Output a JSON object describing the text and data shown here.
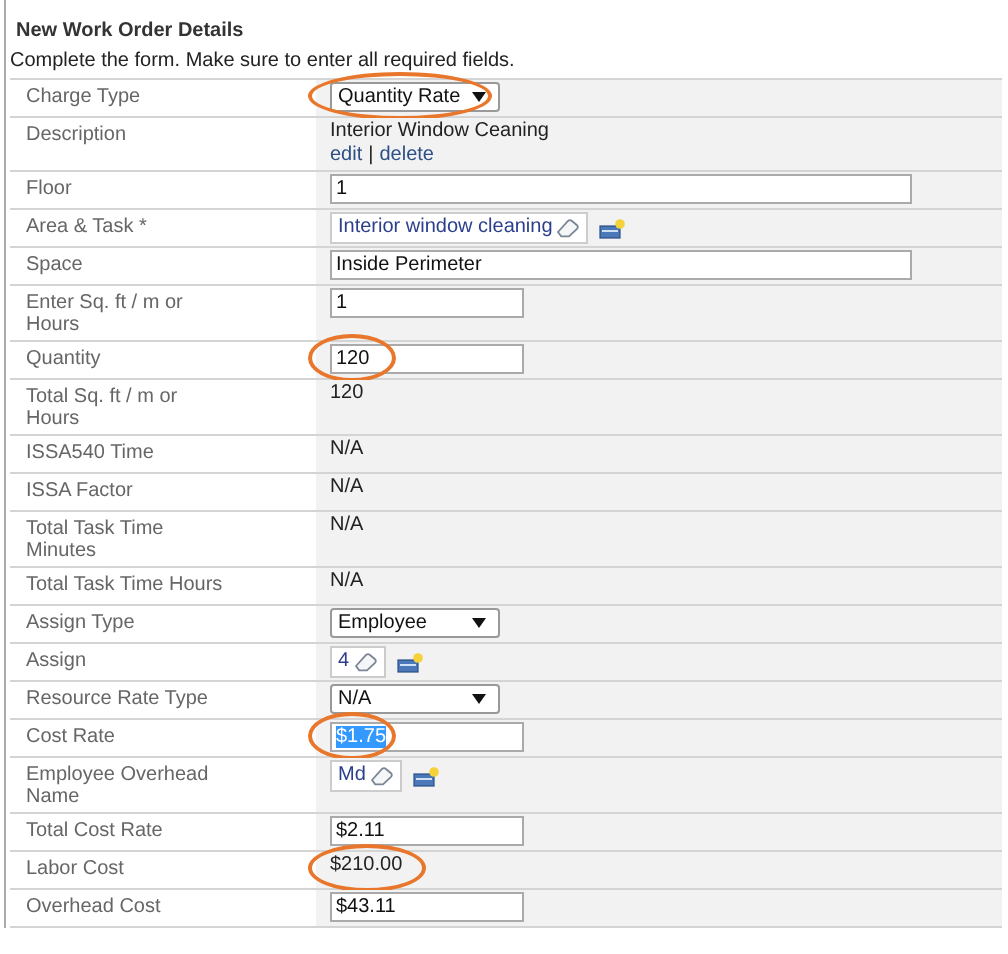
{
  "title": "New Work Order Details",
  "instructions": "Complete the form. Make sure to enter all required fields.",
  "rows": [
    {
      "label": "Charge Type",
      "kind": "select_compact",
      "value": "Quantity Rate",
      "circled": true
    },
    {
      "label": "Description",
      "kind": "links",
      "value": "Interior Window Ceaning",
      "links": [
        "edit",
        "delete"
      ],
      "separator": "|",
      "circled": false
    },
    {
      "label": "Floor",
      "kind": "input_wide",
      "value": "1",
      "circled": false
    },
    {
      "label": "Area & Task *",
      "kind": "lookup",
      "value": "Interior window cleaning",
      "circled": false
    },
    {
      "label": "Space",
      "kind": "input_wide",
      "value": "Inside Perimeter",
      "circled": false
    },
    {
      "label": "Enter Sq. ft / m or Hours",
      "kind": "input_short",
      "value": "1",
      "circled": false
    },
    {
      "label": "Quantity",
      "kind": "input_short",
      "value": "120",
      "circled": true
    },
    {
      "label": "Total Sq. ft / m or Hours",
      "kind": "static",
      "value": "120",
      "circled": false
    },
    {
      "label": "ISSA540 Time",
      "kind": "static",
      "value": "N/A",
      "circled": false
    },
    {
      "label": "ISSA Factor",
      "kind": "static",
      "value": "N/A",
      "circled": false
    },
    {
      "label": "Total Task Time Minutes",
      "kind": "static",
      "value": "N/A",
      "circled": false
    },
    {
      "label": "Total Task Time Hours",
      "kind": "static",
      "value": "N/A",
      "circled": false
    },
    {
      "label": "Assign Type",
      "kind": "select_medium",
      "value": "Employee",
      "circled": false
    },
    {
      "label": "Assign",
      "kind": "lookup",
      "value": "4",
      "circled": false
    },
    {
      "label": "Resource Rate Type",
      "kind": "select_medium",
      "value": "N/A",
      "circled": false
    },
    {
      "label": "Cost Rate",
      "kind": "input_short",
      "value": "$1.75",
      "circled": true,
      "text_selected": true
    },
    {
      "label": "Employee Overhead Name",
      "kind": "lookup",
      "value": "Md",
      "circled": false
    },
    {
      "label": "Total Cost Rate",
      "kind": "input_short",
      "value": "$2.11",
      "circled": false
    },
    {
      "label": "Labor Cost",
      "kind": "static",
      "value": "$210.00",
      "circled": true
    },
    {
      "label": "Overhead Cost",
      "kind": "input_short",
      "value": "$43.11",
      "circled": false
    }
  ]
}
